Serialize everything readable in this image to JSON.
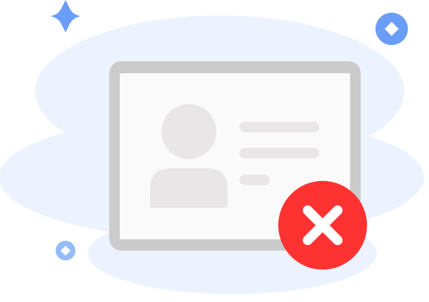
{
  "illustration": {
    "kind": "id-card-verification-failed",
    "icons": {
      "background_blob": "cloud-blob",
      "card": "id-card-icon",
      "avatar": "person-avatar-icon",
      "status": "error-x-icon",
      "sparkle": "four-point-star-icon",
      "diamond_large": "diamond-badge-icon",
      "diamond_small": "diamond-badge-icon"
    },
    "colors": {
      "background_blob": "#edf3fe",
      "card_frame": "#cbcbcb",
      "card_face": "#fafafa",
      "placeholder": "#e8e6e6",
      "error_badge": "#ff3232",
      "error_mark": "#ffffff",
      "accent_blue": "#6a9df5",
      "accent_blue_light": "#94bbfb"
    }
  }
}
